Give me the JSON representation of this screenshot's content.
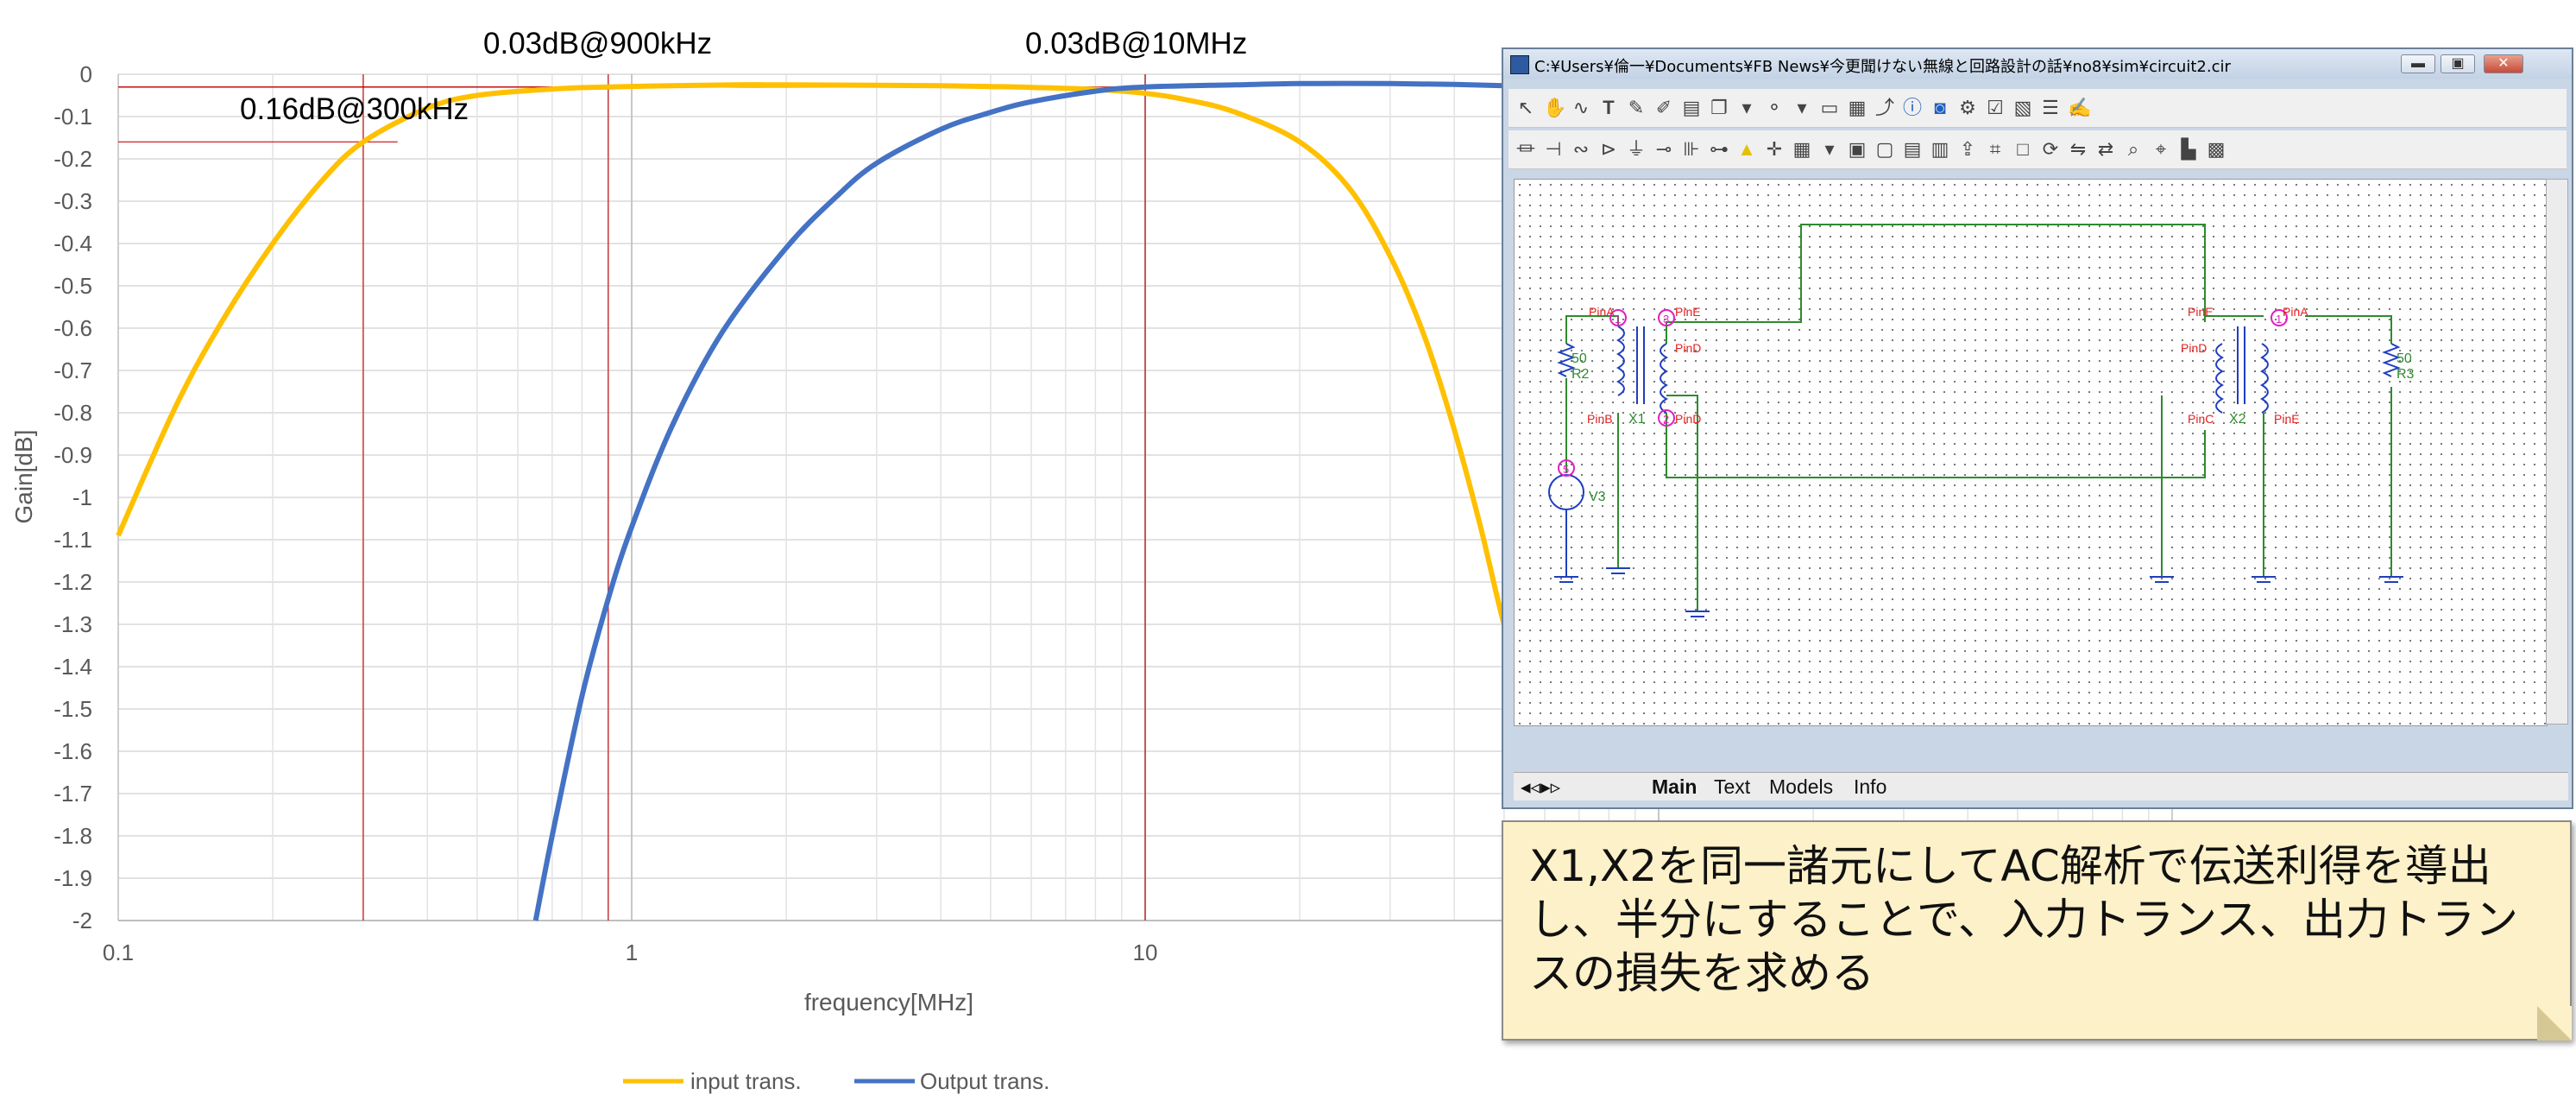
{
  "chart_data": {
    "type": "line",
    "xlabel": "frequency[MHz]",
    "ylabel": "Gain[dB]",
    "xscale": "log",
    "xlim": [
      0.1,
      1000
    ],
    "ylim": [
      -2,
      0
    ],
    "x_ticks": [
      0.1,
      1,
      10,
      100,
      1000
    ],
    "x_tick_labels": [
      "0.1",
      "1",
      "10",
      "",
      ""
    ],
    "y_ticks": [
      "0",
      "-0.1",
      "-0.2",
      "-0.3",
      "-0.4",
      "-0.5",
      "-0.6",
      "-0.7",
      "-0.8",
      "-0.9",
      "-1",
      "-1.1",
      "-1.2",
      "-1.3",
      "-1.4",
      "-1.5",
      "-1.6",
      "-1.7",
      "-1.8",
      "-1.9",
      "-2"
    ],
    "grid": true,
    "legend_position": "bottom",
    "series": [
      {
        "name": "input trans.",
        "color": "#ffc000",
        "x": [
          0.1,
          0.13,
          0.16,
          0.2,
          0.25,
          0.3,
          0.4,
          0.5,
          0.7,
          0.9,
          1.2,
          1.6,
          2,
          3,
          4,
          5,
          6,
          8,
          10,
          12,
          15,
          20,
          25,
          30,
          35,
          40,
          45,
          50,
          55
        ],
        "y": [
          -1.09,
          -0.78,
          -0.58,
          -0.4,
          -0.25,
          -0.16,
          -0.08,
          -0.05,
          -0.035,
          -0.03,
          -0.027,
          -0.025,
          -0.025,
          -0.026,
          -0.027,
          -0.029,
          -0.031,
          -0.036,
          -0.045,
          -0.06,
          -0.09,
          -0.16,
          -0.27,
          -0.43,
          -0.62,
          -0.84,
          -1.07,
          -1.3,
          -1.45
        ]
      },
      {
        "name": "Output trans.",
        "color": "#4472c4",
        "x": [
          0.65,
          0.7,
          0.8,
          0.9,
          1.0,
          1.2,
          1.5,
          2,
          2.5,
          3,
          4,
          5,
          6,
          8,
          10,
          15,
          20,
          30,
          40,
          50,
          60
        ],
        "y": [
          -2.0,
          -1.8,
          -1.47,
          -1.24,
          -1.07,
          -0.83,
          -0.61,
          -0.41,
          -0.29,
          -0.21,
          -0.13,
          -0.09,
          -0.065,
          -0.04,
          -0.03,
          -0.025,
          -0.022,
          -0.022,
          -0.024,
          -0.027,
          -0.03
        ]
      }
    ],
    "markers": [
      {
        "x": 0.3,
        "y": -0.16,
        "label": "0.16dB@300kHz"
      },
      {
        "x": 0.9,
        "y": -0.03,
        "label": "0.03dB@900kHz"
      },
      {
        "x": 10,
        "y": -0.03,
        "label": "0.03dB@10MHz"
      }
    ]
  },
  "legend": {
    "input": "input trans.",
    "output": "Output trans."
  },
  "annotations": {
    "a300k": "0.16dB@300kHz",
    "a900k": "0.03dB@900kHz",
    "a10M": "0.03dB@10MHz"
  },
  "window": {
    "title": "C:¥Users¥倫一¥Documents¥FB News¥今更聞けない無線と回路設計の話¥no8¥sim¥circuit2.cir",
    "minimize": "▬",
    "maximize": "▣",
    "close": "✕",
    "tabs": [
      "Main",
      "Text",
      "Models",
      "Info"
    ],
    "components": {
      "r2_value": "50",
      "r2_name": "R2",
      "r3_value": "50",
      "r3_name": "R3",
      "x1": "X1",
      "x2": "X2",
      "v3": "V3",
      "pin_a": "PinA",
      "pin_b": "PinB",
      "pin_c": "PinC",
      "pin_d": "PinD",
      "pin_e": "PinE",
      "node1": "1",
      "node2": "2",
      "node3": "3",
      "node5": "5"
    }
  },
  "note": {
    "text": "X1,X2を同一諸元にしてAC解析で伝送利得を導出し、半分にすることで、入力トランス、出力トランスの損失を求める"
  }
}
